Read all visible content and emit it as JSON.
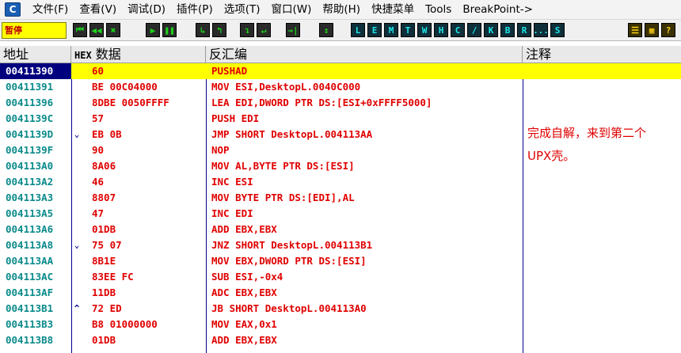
{
  "app": {
    "icon": "debugger-app-icon"
  },
  "menu": {
    "items": [
      "文件(F)",
      "查看(V)",
      "调试(D)",
      "插件(P)",
      "选项(T)",
      "窗口(W)",
      "帮助(H)",
      "快捷菜单",
      "Tools",
      "BreakPoint->"
    ]
  },
  "toolbar": {
    "status": "暂停",
    "buttons": [
      "⏮",
      "◀◀",
      "✖",
      "▶",
      "❚❚",
      "↳",
      "↰",
      "↴",
      "↵",
      "→|",
      "↕",
      "L",
      "E",
      "M",
      "T",
      "W",
      "H",
      "C",
      "/",
      "K",
      "B",
      "R",
      "...",
      "S",
      "☰",
      "▦",
      "?"
    ]
  },
  "columns": {
    "address": "地址",
    "hex_prefix": "HEX",
    "hex_label": "数据",
    "disasm": "反汇编",
    "comment": "注释"
  },
  "rows": [
    {
      "address": "00411390",
      "arrow": "",
      "hex": "60",
      "disasm": "PUSHAD",
      "selected": true
    },
    {
      "address": "00411391",
      "arrow": "",
      "hex": "BE 00C04000",
      "disasm": "MOV ESI,DesktopL.0040C000"
    },
    {
      "address": "00411396",
      "arrow": "",
      "hex": "8DBE 0050FFFF",
      "disasm": "LEA EDI,DWORD PTR DS:[ESI+0xFFFF5000]"
    },
    {
      "address": "0041139C",
      "arrow": "",
      "hex": "57",
      "disasm": "PUSH EDI"
    },
    {
      "address": "0041139D",
      "arrow": "⌄",
      "hex": "EB 0B",
      "disasm": "JMP SHORT DesktopL.004113AA"
    },
    {
      "address": "0041139F",
      "arrow": "",
      "hex": "90",
      "disasm": "NOP"
    },
    {
      "address": "004113A0",
      "arrow": "",
      "hex": "8A06",
      "disasm": "MOV AL,BYTE PTR DS:[ESI]"
    },
    {
      "address": "004113A2",
      "arrow": "",
      "hex": "46",
      "disasm": "INC ESI"
    },
    {
      "address": "004113A3",
      "arrow": "",
      "hex": "8807",
      "disasm": "MOV BYTE PTR DS:[EDI],AL"
    },
    {
      "address": "004113A5",
      "arrow": "",
      "hex": "47",
      "disasm": "INC EDI"
    },
    {
      "address": "004113A6",
      "arrow": "",
      "hex": "01DB",
      "disasm": "ADD EBX,EBX"
    },
    {
      "address": "004113A8",
      "arrow": "⌄",
      "hex": "75 07",
      "disasm": "JNZ SHORT DesktopL.004113B1"
    },
    {
      "address": "004113AA",
      "arrow": "",
      "hex": "8B1E",
      "disasm": "MOV EBX,DWORD PTR DS:[ESI]"
    },
    {
      "address": "004113AC",
      "arrow": "",
      "hex": "83EE FC",
      "disasm": "SUB ESI,-0x4"
    },
    {
      "address": "004113AF",
      "arrow": "",
      "hex": "11DB",
      "disasm": "ADC EBX,EBX"
    },
    {
      "address": "004113B1",
      "arrow": "^",
      "hex": "72 ED",
      "disasm": "JB SHORT DesktopL.004113A0"
    },
    {
      "address": "004113B3",
      "arrow": "",
      "hex": "B8 01000000",
      "disasm": "MOV EAX,0x1"
    },
    {
      "address": "004113B8",
      "arrow": "",
      "hex": "01DB",
      "disasm": "ADD EBX,EBX"
    }
  ],
  "annotation": "完成自解，来到第二个UPX壳。",
  "colors": {
    "selection": "#ffff00",
    "address_text": "#0a8a8a",
    "code_text": "#e00000",
    "address_selected_bg": "#00007f"
  }
}
